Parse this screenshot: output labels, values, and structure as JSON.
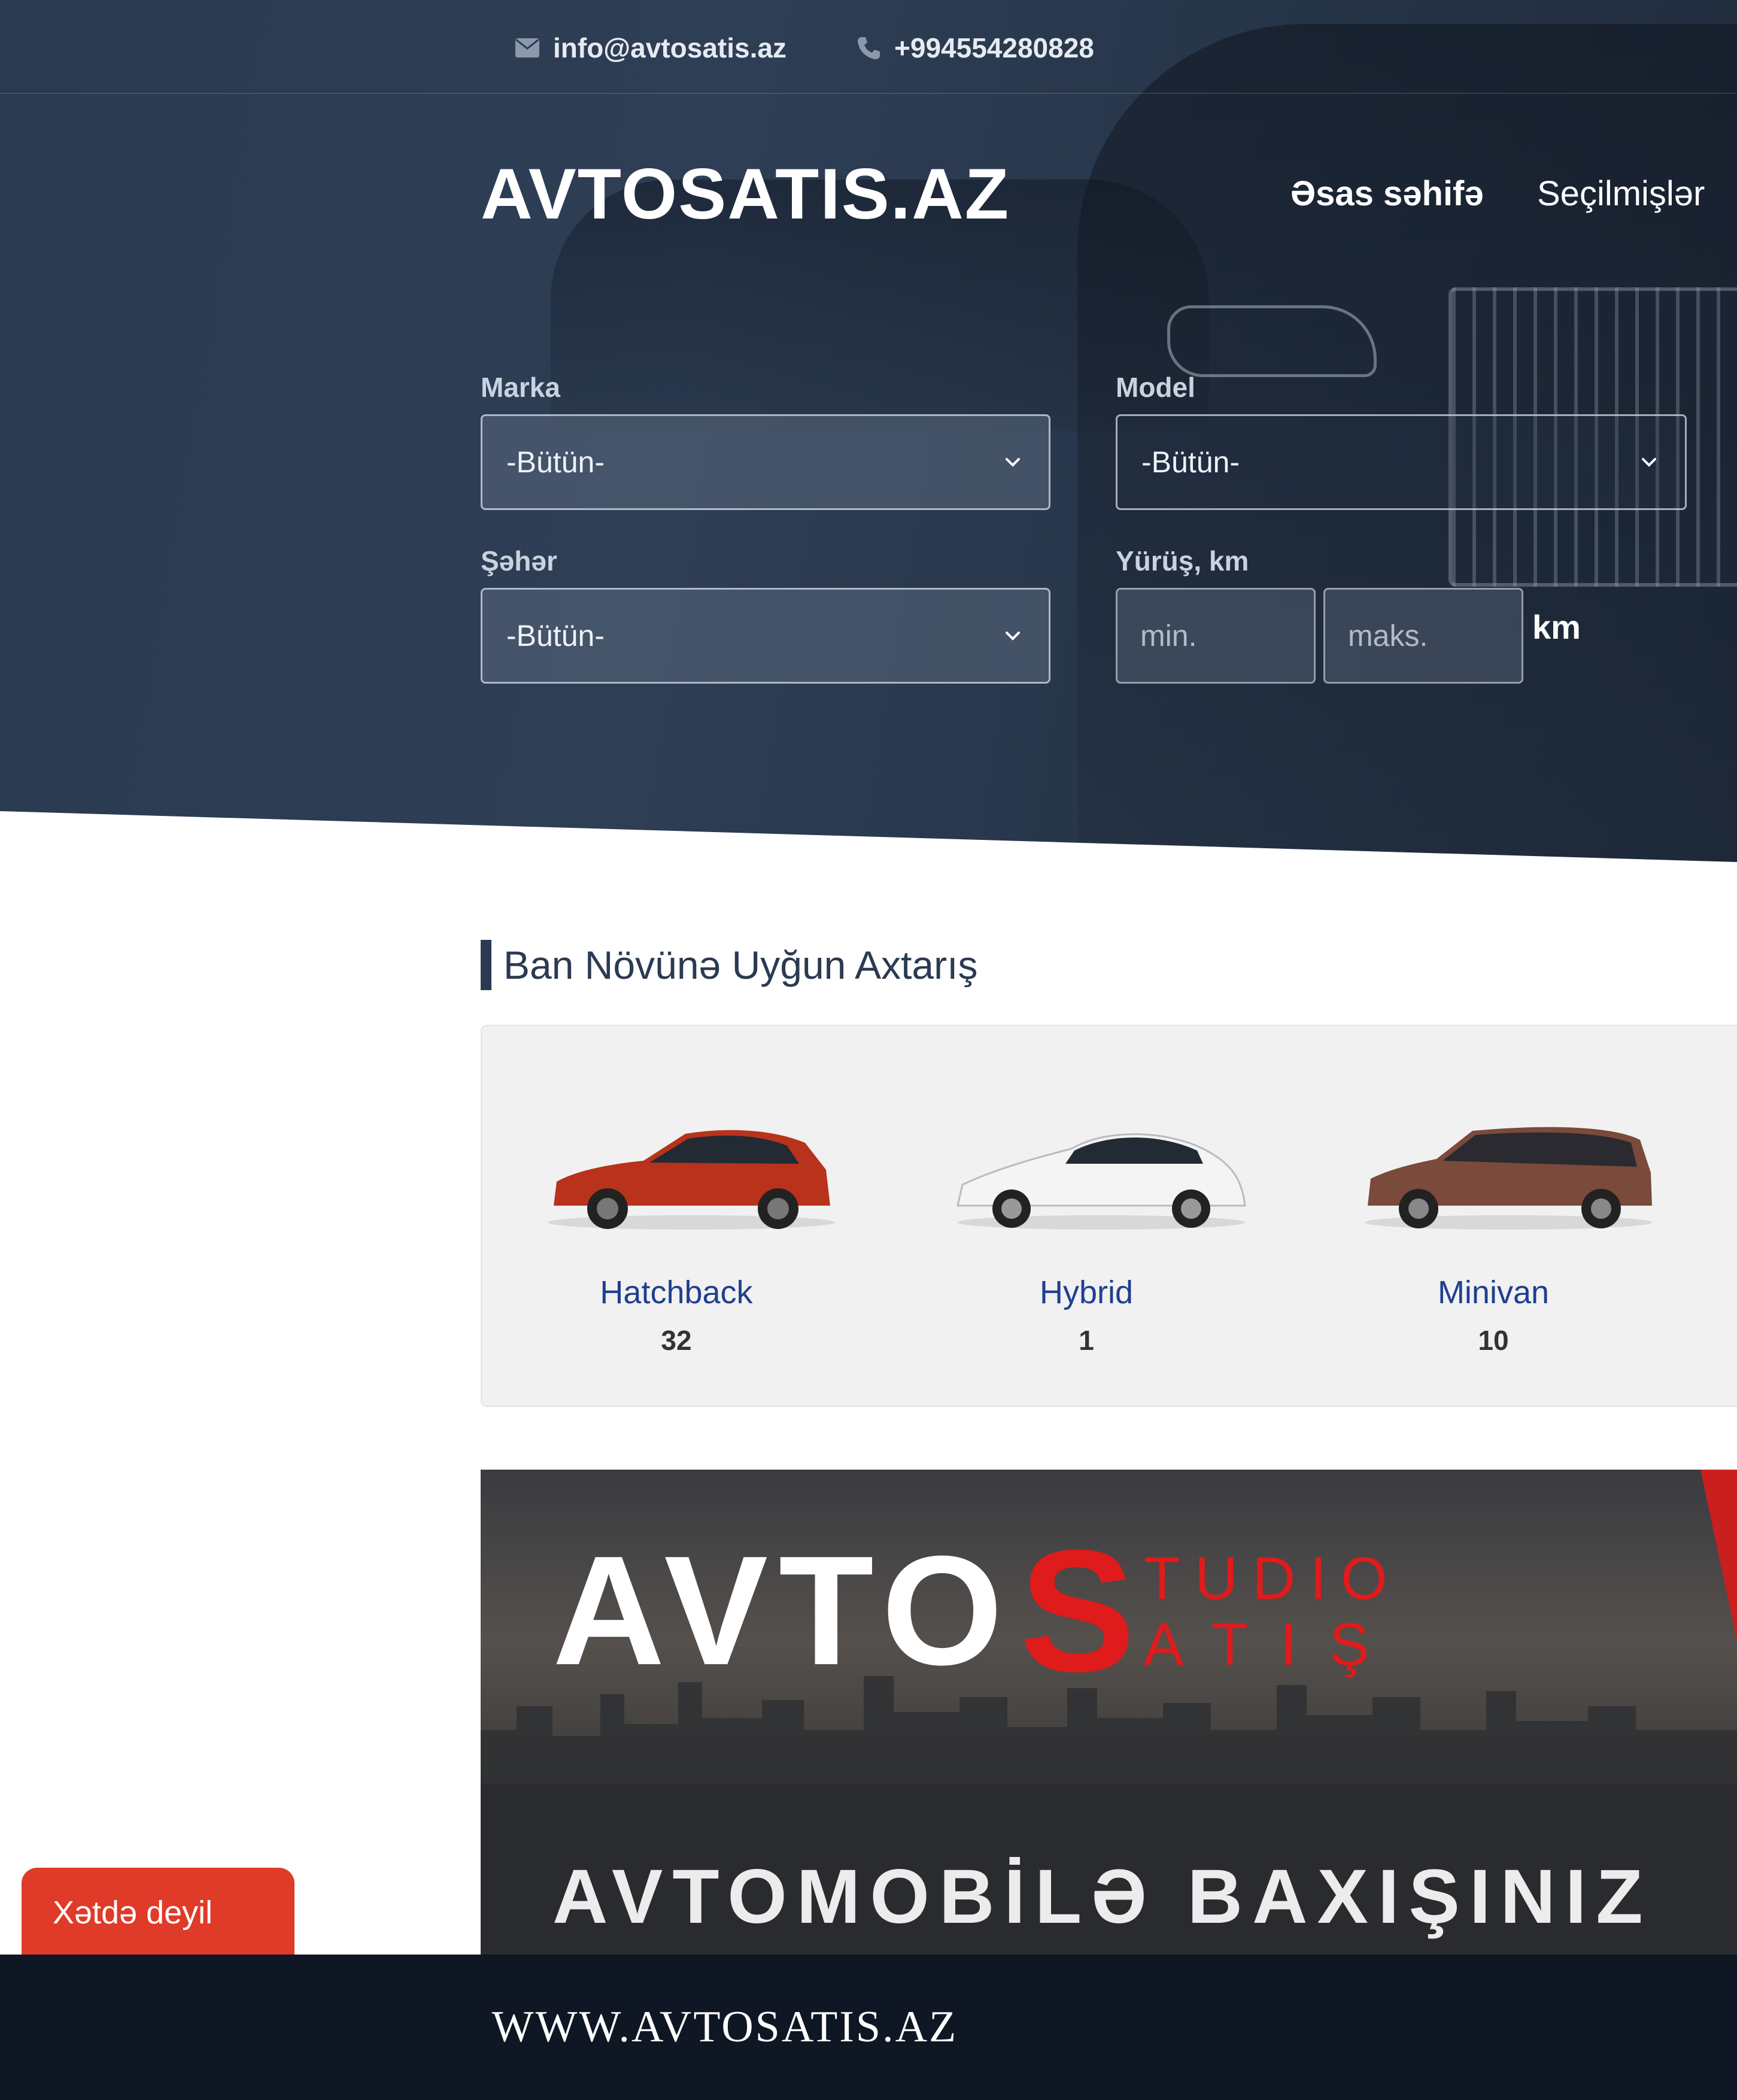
{
  "topbar": {
    "email": "info@avtosatis.az",
    "phone": "+994554280828"
  },
  "header": {
    "logo": "AVTOSATIS.AZ",
    "nav": [
      "Əsas səhifə",
      "Seçilmişlər"
    ]
  },
  "search": {
    "marka_label": "Marka",
    "marka_value": "-Bütün-",
    "model_label": "Model",
    "model_value": "-Bütün-",
    "city_label": "Şəhər",
    "city_value": "-Bütün-",
    "mileage_label": "Yürüş, km",
    "mileage_min_placeholder": "min.",
    "mileage_max_placeholder": "maks.",
    "mileage_unit": "km"
  },
  "body_types": {
    "title": "Ban Növünə Uyğun Axtarış",
    "items": [
      {
        "name": "Hatchback",
        "count": "32",
        "color": "#b8321c"
      },
      {
        "name": "Hybrid",
        "count": "1",
        "color": "#eeeeee"
      },
      {
        "name": "Minivan",
        "count": "10",
        "color": "#7a4a3a"
      }
    ]
  },
  "banner": {
    "brand_avto": "AVTO",
    "brand_s": "S",
    "brand_studio": "TUDIO",
    "brand_atis": "ATIŞ",
    "tagline": "AVTOMOBİLƏ BAXIŞINIZ"
  },
  "status_button": "Xətdə deyil",
  "footer": {
    "url": "WWW.AVTOSATIS.AZ"
  },
  "colors": {
    "hero_bg": "#2a3a50",
    "accent_red": "#e03a28",
    "link_blue": "#1f3f8f"
  }
}
